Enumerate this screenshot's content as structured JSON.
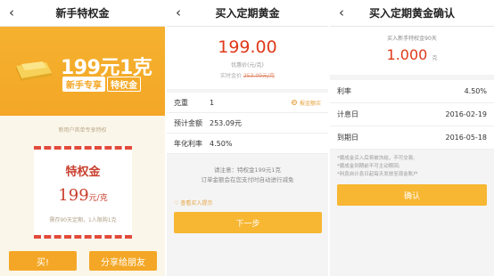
{
  "screen1": {
    "back_icon": "chevron-left-icon",
    "title": "新手特权金",
    "banner": {
      "amount": "199元",
      "gram": "1克",
      "tag_primary": "新手专享",
      "tag_secondary": "特权金"
    },
    "hint": "新用户首单专享特权",
    "voucher": {
      "title": "特权金",
      "price": "199",
      "unit": "元/克",
      "note": "需存90天定期，1人限购1克"
    },
    "buy_label": "买!",
    "share_label": "分享给朋友"
  },
  "screen2": {
    "back_icon": "chevron-left-icon",
    "title": "买入定期黄金",
    "price": "199.00",
    "price_label": "优惠价(元/克)",
    "price_old_label": "实时金价",
    "price_old_value": "253.09元/克",
    "rows": [
      {
        "label": "克重",
        "value": "1",
        "link": "报金额买"
      },
      {
        "label": "预计金额",
        "value": "253.09元"
      },
      {
        "label": "年化利率",
        "value": "4.50%"
      }
    ],
    "note_line1": "请注意：特权金199元1克",
    "note_line2": "订单金额会在您支付时自动进行减免",
    "buy_tip": "查看买入提示",
    "next_label": "下一步"
  },
  "screen3": {
    "back_icon": "chevron-left-icon",
    "title": "买入定期黄金确认",
    "amount_label": "买入新手特权金90天",
    "amount": "1.000",
    "amount_unit": "克",
    "rows": [
      {
        "label": "利率",
        "value": "4.50%"
      },
      {
        "label": "计息日",
        "value": "2016-02-19"
      },
      {
        "label": "到期日",
        "value": "2016-05-18"
      }
    ],
    "tip1": "*顺成金买入后将被冻结，不可交易;",
    "tip2": "*顺成金到期前不可主动赎回;",
    "tip3": "*利息自计息日起每天发放至现金账户",
    "confirm_label": "确认"
  },
  "colors": {
    "accent": "#f4a726",
    "price_red": "#e0391a",
    "voucher_red": "#c9402e"
  }
}
